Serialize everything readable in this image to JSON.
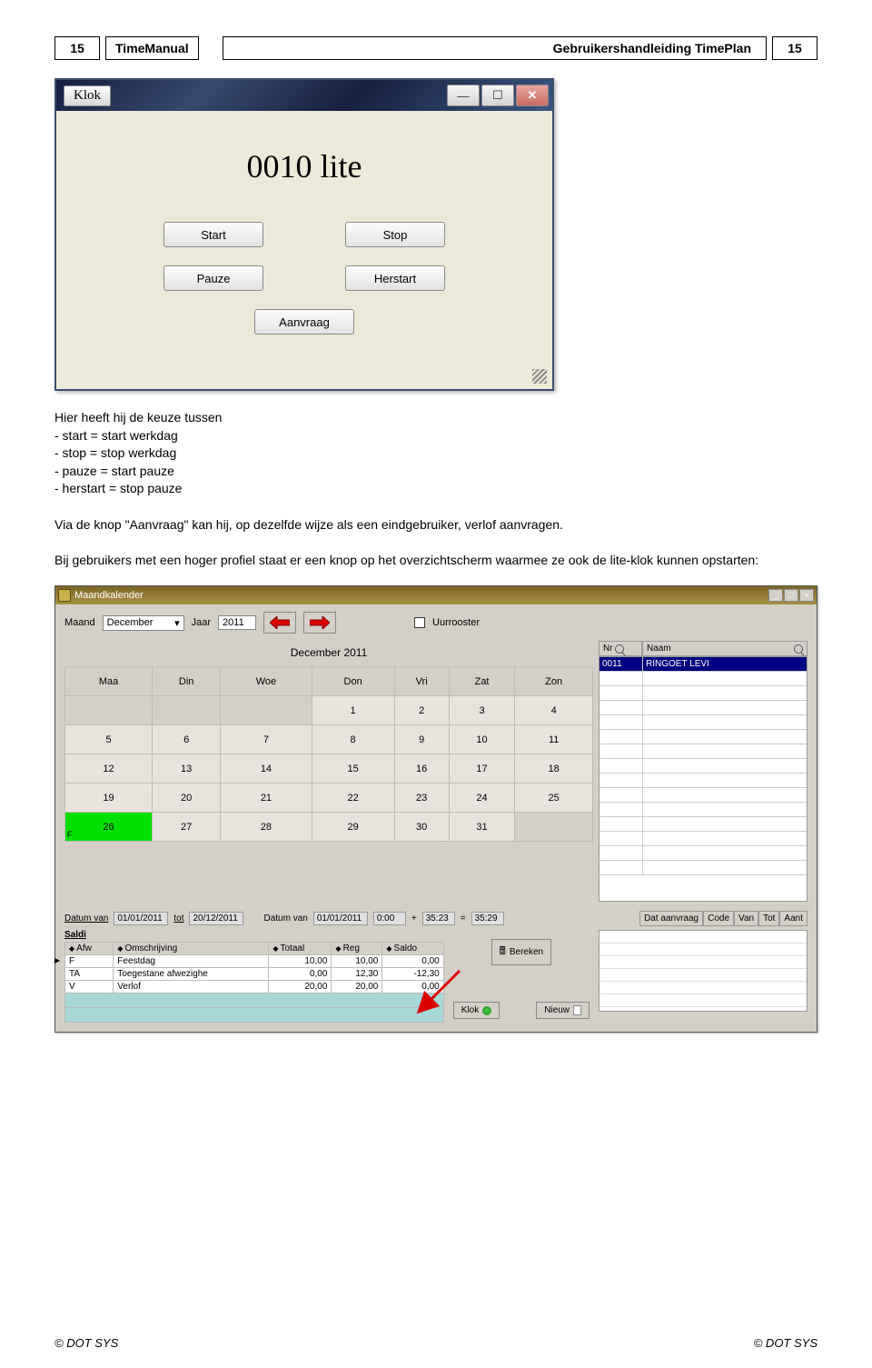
{
  "header": {
    "page_left": "15",
    "app": "TimeManual",
    "title": "Gebruikershandleiding TimePlan",
    "page_right": "15"
  },
  "klok": {
    "title": "Klok",
    "big": "0010 lite",
    "buttons": {
      "start": "Start",
      "stop": "Stop",
      "pauze": "Pauze",
      "herstart": "Herstart",
      "aanvraag": "Aanvraag"
    }
  },
  "text": {
    "intro": "Hier heeft hij de keuze tussen",
    "l1": "- start = start werkdag",
    "l2": "- stop = stop werkdag",
    "l3": "- pauze = start pauze",
    "l4": "- herstart = stop pauze",
    "para2": "Via de knop \"Aanvraag\" kan hij, op dezelfde wijze als een eindgebruiker, verlof aanvragen.",
    "para3": "Bij gebruikers met een hoger profiel staat er een knop op het overzichtscherm  waarmee ze ook de lite-klok kunnen opstarten:"
  },
  "mk": {
    "title": "Maandkalender",
    "month_label": "Maand",
    "month_value": "December",
    "year_label": "Jaar",
    "year_value": "2011",
    "uurrooster": "Uurrooster",
    "cal_title": "December 2011",
    "dow": [
      "Maa",
      "Din",
      "Woe",
      "Don",
      "Vri",
      "Zat",
      "Zon"
    ],
    "weeks": [
      [
        "",
        "",
        "",
        "1",
        "2",
        "3",
        "4"
      ],
      [
        "5",
        "6",
        "7",
        "8",
        "9",
        "10",
        "11"
      ],
      [
        "12",
        "13",
        "14",
        "15",
        "16",
        "17",
        "18"
      ],
      [
        "19",
        "20",
        "21",
        "22",
        "23",
        "24",
        "25"
      ],
      [
        "26",
        "27",
        "28",
        "29",
        "30",
        "31",
        ""
      ]
    ],
    "today": "26",
    "today_marker": "F",
    "right": {
      "nr": "Nr",
      "naam": "Naam",
      "row": {
        "nr": "0011",
        "naam": "RINGOET LEVI"
      }
    },
    "mid": {
      "datum_van": "Datum van",
      "d1": "01/01/2011",
      "tot": "tot",
      "d2": "20/12/2011",
      "datum_van2": "Datum van",
      "d3": "01/01/2011",
      "t1": "0:00",
      "plus": "+",
      "t2": "35:23",
      "eq": "=",
      "t3": "35:29",
      "right_hdr": [
        "Dat aanvraag",
        "Code",
        "Van",
        "Tot",
        "Aant"
      ],
      "bereken": "Bereken"
    },
    "saldi": {
      "title": "Saldi",
      "cols": [
        "Afw",
        "Omschrijving",
        "Totaal",
        "Reg",
        "Saldo"
      ],
      "rows": [
        [
          "F",
          "Feestdag",
          "10,00",
          "10,00",
          "0,00"
        ],
        [
          "TA",
          "Toegestane afwezighe",
          "0,00",
          "12,30",
          "-12,30"
        ],
        [
          "V",
          "Verlof",
          "20,00",
          "20,00",
          "0,00"
        ]
      ]
    },
    "klok_btn": "Klok",
    "nieuw_btn": "Nieuw"
  },
  "footer": {
    "left": "© DOT SYS",
    "right": "© DOT SYS"
  }
}
